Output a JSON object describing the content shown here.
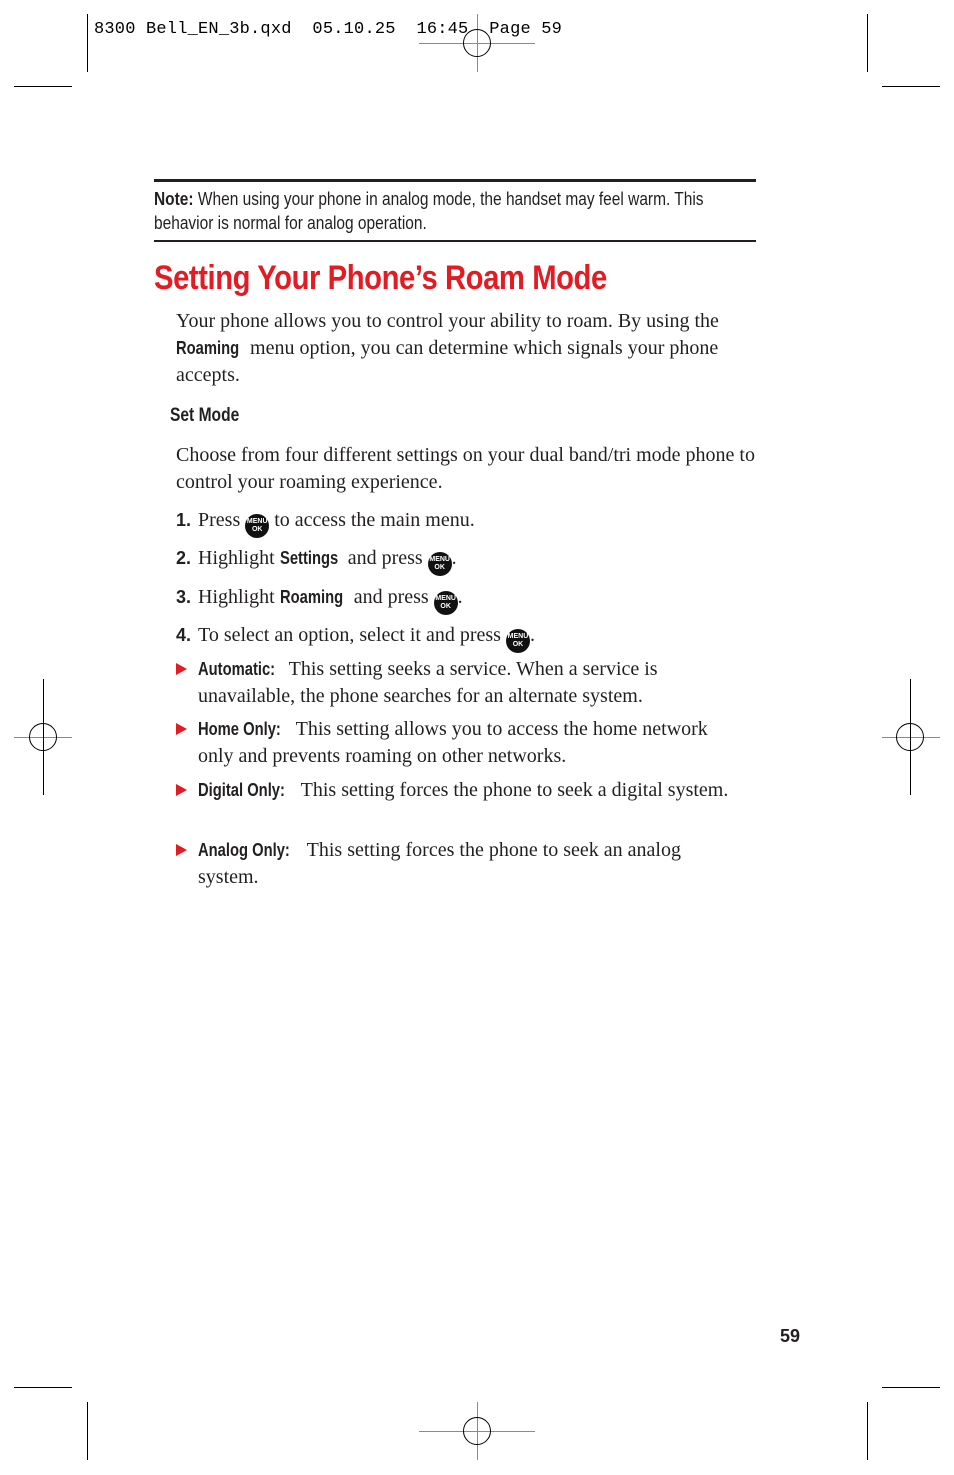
{
  "slug_line": "8300 Bell_EN_3b.qxd  05.10.25  16:45  Page 59",
  "note": {
    "label": "Note:",
    "text": " When using your phone in analog mode, the handset may feel warm. This behavior is normal for analog operation."
  },
  "section_title": "Setting Your Phone’s Roam Mode",
  "intro": {
    "before": "Your phone allows you to control your ability to roam. By using the ",
    "bold": "Roaming",
    "after": " menu option, you can determine which signals your phone accepts."
  },
  "subheading": "Set Mode",
  "subheading_text": "Choose from four different settings on your dual band/tri mode phone to control your roaming experience.",
  "menu_button": {
    "line1": "MENU",
    "line2": "OK"
  },
  "steps": [
    {
      "num": "1.",
      "before": "Press ",
      "bold": "",
      "after": " to access the main menu."
    },
    {
      "num": "2.",
      "before": "Highlight ",
      "bold": "Settings",
      "after": " and press "
    },
    {
      "num": "3.",
      "before": "Highlight ",
      "bold": "Roaming",
      "after": " and press "
    },
    {
      "num": "4.",
      "before": "To select an option, select it and press ",
      "bold": "",
      "after": ""
    }
  ],
  "options": [
    {
      "label": "Automatic:",
      "text": " This setting seeks a service. When a service is unavailable, the phone searches for an alternate system."
    },
    {
      "label": "Home Only:",
      "text": " This setting allows you to access the home network only and prevents roaming on other networks."
    },
    {
      "label": "Digital Only:",
      "text": " This setting forces the phone to seek a digital system."
    },
    {
      "label": "Analog Only:",
      "text": " This setting forces the phone to seek an analog system."
    }
  ],
  "page_number": "59",
  "colors": {
    "accent": "#e31b23",
    "text": "#231f20"
  }
}
